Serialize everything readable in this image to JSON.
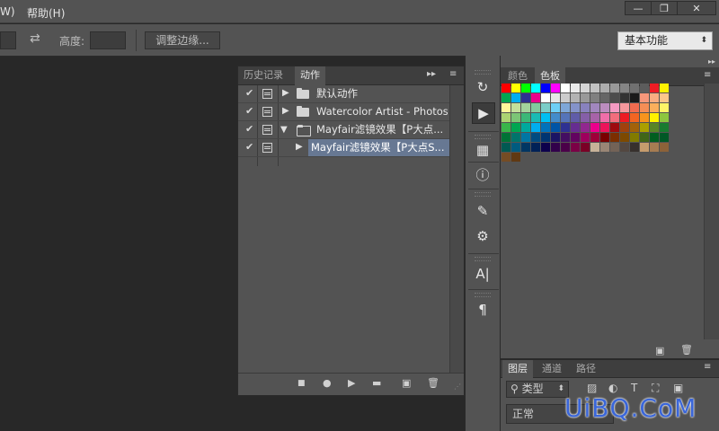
{
  "menubar": {
    "items": [
      "W)",
      "帮助(H)"
    ],
    "window_buttons": [
      "—",
      "❐",
      "✕"
    ]
  },
  "options": {
    "height_label": "高度:",
    "refine_edge_button": "调整边缘...",
    "workspace_select": "基本功能"
  },
  "actions_panel": {
    "tabs": [
      "历史记录",
      "动作"
    ],
    "active_tab": "动作",
    "items": [
      {
        "checked": true,
        "expanded": false,
        "type": "set",
        "label": "默认动作"
      },
      {
        "checked": true,
        "expanded": false,
        "type": "set",
        "label": "Watercolor Artist - Photos..."
      },
      {
        "checked": true,
        "expanded": true,
        "type": "set",
        "label": "Mayfair滤镜效果【P大点..."
      },
      {
        "checked": true,
        "expanded": false,
        "type": "action",
        "label": "Mayfair滤镜效果【P大点S...",
        "selected": true
      }
    ],
    "bottom_icons": [
      "stop-icon",
      "record-icon",
      "play-icon",
      "new-set-icon",
      "new-action-icon",
      "trash-icon"
    ]
  },
  "dock": {
    "icons": [
      "history-brush-icon",
      "play-icon",
      "tool-presets-icon",
      "info-icon",
      "brushes-icon",
      "brush-settings-icon",
      "character-icon",
      "paragraph-icon"
    ]
  },
  "swatches_panel": {
    "tabs": [
      "颜色",
      "色板"
    ],
    "active_tab": "色板",
    "rows": [
      [
        "#ff0000",
        "#ffff00",
        "#00ff00",
        "#00ffff",
        "#0000ff",
        "#ff00ff",
        "#ffffff",
        "#ebebeb",
        "#d6d6d6",
        "#c2c2c2",
        "#adadad",
        "#999999",
        "#858585",
        "#707070",
        "#5c5c5c",
        "#ed1c24",
        "#fff200"
      ],
      [
        "#00a651",
        "#00aeef",
        "#2e3192",
        "#ec008c",
        "#ffffff",
        "#e6e6e6",
        "#cccccc",
        "#b3b3b3",
        "#999999",
        "#808080",
        "#666666",
        "#4d4d4d",
        "#333333",
        "#1a1a1a",
        "#f7977a",
        "#f9ad81",
        "#fdc68a"
      ],
      [
        "#fff79a",
        "#c4df9b",
        "#a3d39c",
        "#82ca9d",
        "#7bcdc8",
        "#6ecff6",
        "#7ea7d8",
        "#8493ca",
        "#8882be",
        "#a187be",
        "#bc8dbf",
        "#f49ac2",
        "#f6989d",
        "#f26c4f",
        "#f68e56",
        "#fbaf5c",
        "#fff467"
      ],
      [
        "#acd372",
        "#7cc576",
        "#3bb878",
        "#1abbb4",
        "#00bff3",
        "#438ccb",
        "#5574b9",
        "#605ca8",
        "#855fa8",
        "#a763a8",
        "#f06ea9",
        "#f26d7d",
        "#ed1c24",
        "#f26522",
        "#f7941d",
        "#fff200",
        "#8dc63f"
      ],
      [
        "#39b54a",
        "#00a651",
        "#00a99d",
        "#00aeef",
        "#0072bc",
        "#0054a6",
        "#2e3192",
        "#662d91",
        "#92278f",
        "#ec008c",
        "#ed145b",
        "#9e0b0f",
        "#a0410d",
        "#a36209",
        "#aba000",
        "#598527",
        "#197b30"
      ],
      [
        "#007236",
        "#00746b",
        "#0076a3",
        "#004b80",
        "#003471",
        "#1b1464",
        "#440e62",
        "#630460",
        "#9e005d",
        "#9e0039",
        "#790000",
        "#7b2e00",
        "#7d4900",
        "#827b00",
        "#406618",
        "#005e20",
        "#005826"
      ],
      [
        "#005952",
        "#005b7f",
        "#003663",
        "#002157",
        "#0d004c",
        "#32004b",
        "#4b0049",
        "#7b0046",
        "#7a0026",
        "#c7b299",
        "#998675",
        "#736357",
        "#534741",
        "#37302d",
        "#c69c6d",
        "#a67c52",
        "#8c6239"
      ],
      [
        "#754c24",
        "#603913"
      ]
    ]
  },
  "layers_panel": {
    "tabs": [
      "图层",
      "通道",
      "路径"
    ],
    "active_tab": "图层",
    "filter_label": "类型",
    "blend_mode": "正常"
  },
  "watermark": "UiBQ.CoM"
}
